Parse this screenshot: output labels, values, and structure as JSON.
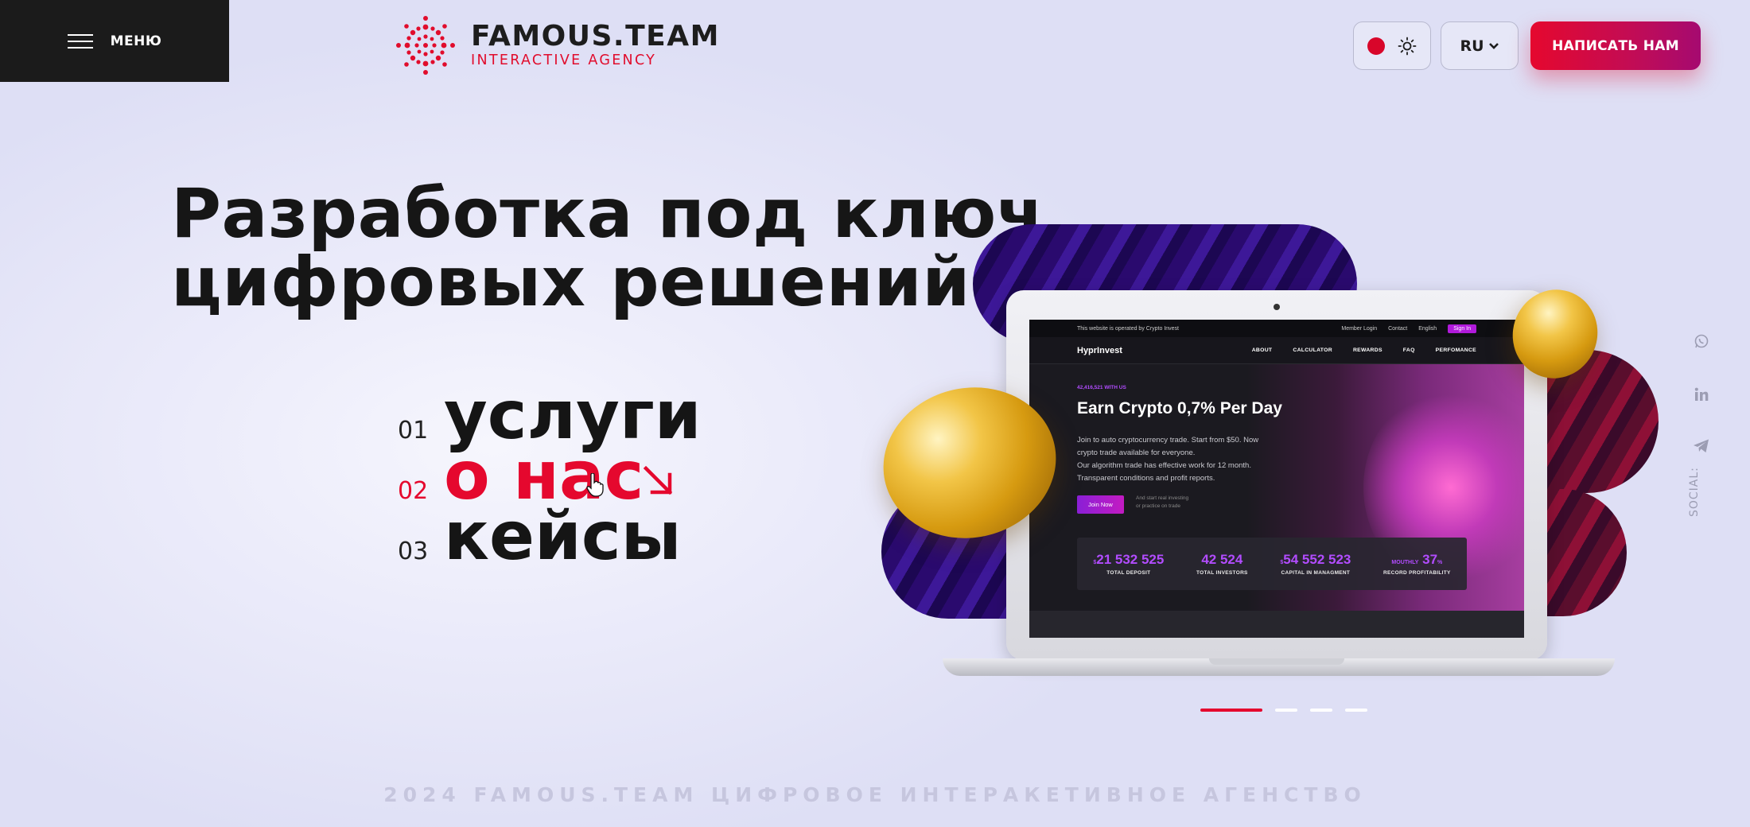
{
  "header": {
    "menu_label": "МЕНЮ",
    "brand": "FAMOUS.TEAM",
    "tagline": "INTERACTIVE AGENCY",
    "language": "RU",
    "cta_label": "НАПИСАТЬ НАМ"
  },
  "hero": {
    "title_line1": "Разработка под ключ",
    "title_line2": "цифровых решений"
  },
  "nav": {
    "items": [
      {
        "num": "01",
        "label": "услуги"
      },
      {
        "num": "02",
        "label": "о нас"
      },
      {
        "num": "03",
        "label": "кейсы"
      }
    ]
  },
  "mockup": {
    "topbar_notice": "This website is operated by Crypto Invest",
    "member_login": "Member Login",
    "contact": "Contact",
    "language": "English",
    "sign_in": "Sign In",
    "site_name": "HyprInvest",
    "links": [
      "ABOUT",
      "CALCULATOR",
      "REWARDS",
      "FAQ",
      "PERFOMANCE"
    ],
    "small_label": "42,416,521 WITH US",
    "title": "Earn Crypto 0,7% Per Day",
    "desc_line1": "Join to auto cryptocurrency trade. Start from $50. Now",
    "desc_line2": "crypto trade available for everyone.",
    "desc_line3": "Our algorithm trade has effective work for 12 month.",
    "desc_line4": "Transparent conditions and profit reports.",
    "join_label": "Join Now",
    "join_note_1": "And start real investing",
    "join_note_2": "or practice on trade",
    "stats": [
      {
        "prefix": "$",
        "value": "21 532 525",
        "label": "TOTAL DEPOSIT"
      },
      {
        "prefix": "",
        "value": "42 524",
        "label": "TOTAL INVESTORS"
      },
      {
        "prefix": "$",
        "value": "54 552 523",
        "label": "CAPITAL IN MANAGMENT"
      },
      {
        "prefix": "MOUTHLY",
        "value": "37",
        "suffix": "%",
        "label": "RECORD PROFITABILITY"
      }
    ]
  },
  "social": {
    "label": "SOCIAL:",
    "icons": [
      "whatsapp-icon",
      "linkedin-icon",
      "telegram-icon"
    ]
  },
  "slider": {
    "count": 4,
    "active": 1
  },
  "footer": {
    "text": "2024 FAMOUS.TEAM ЦИФРОВОЕ ИНТЕРАКЕТИВНОЕ АГЕНСТВО"
  },
  "colors": {
    "accent": "#e5082e",
    "dark": "#1b1b1b",
    "purple": "#b24cff",
    "background": "#e6e6f8"
  }
}
